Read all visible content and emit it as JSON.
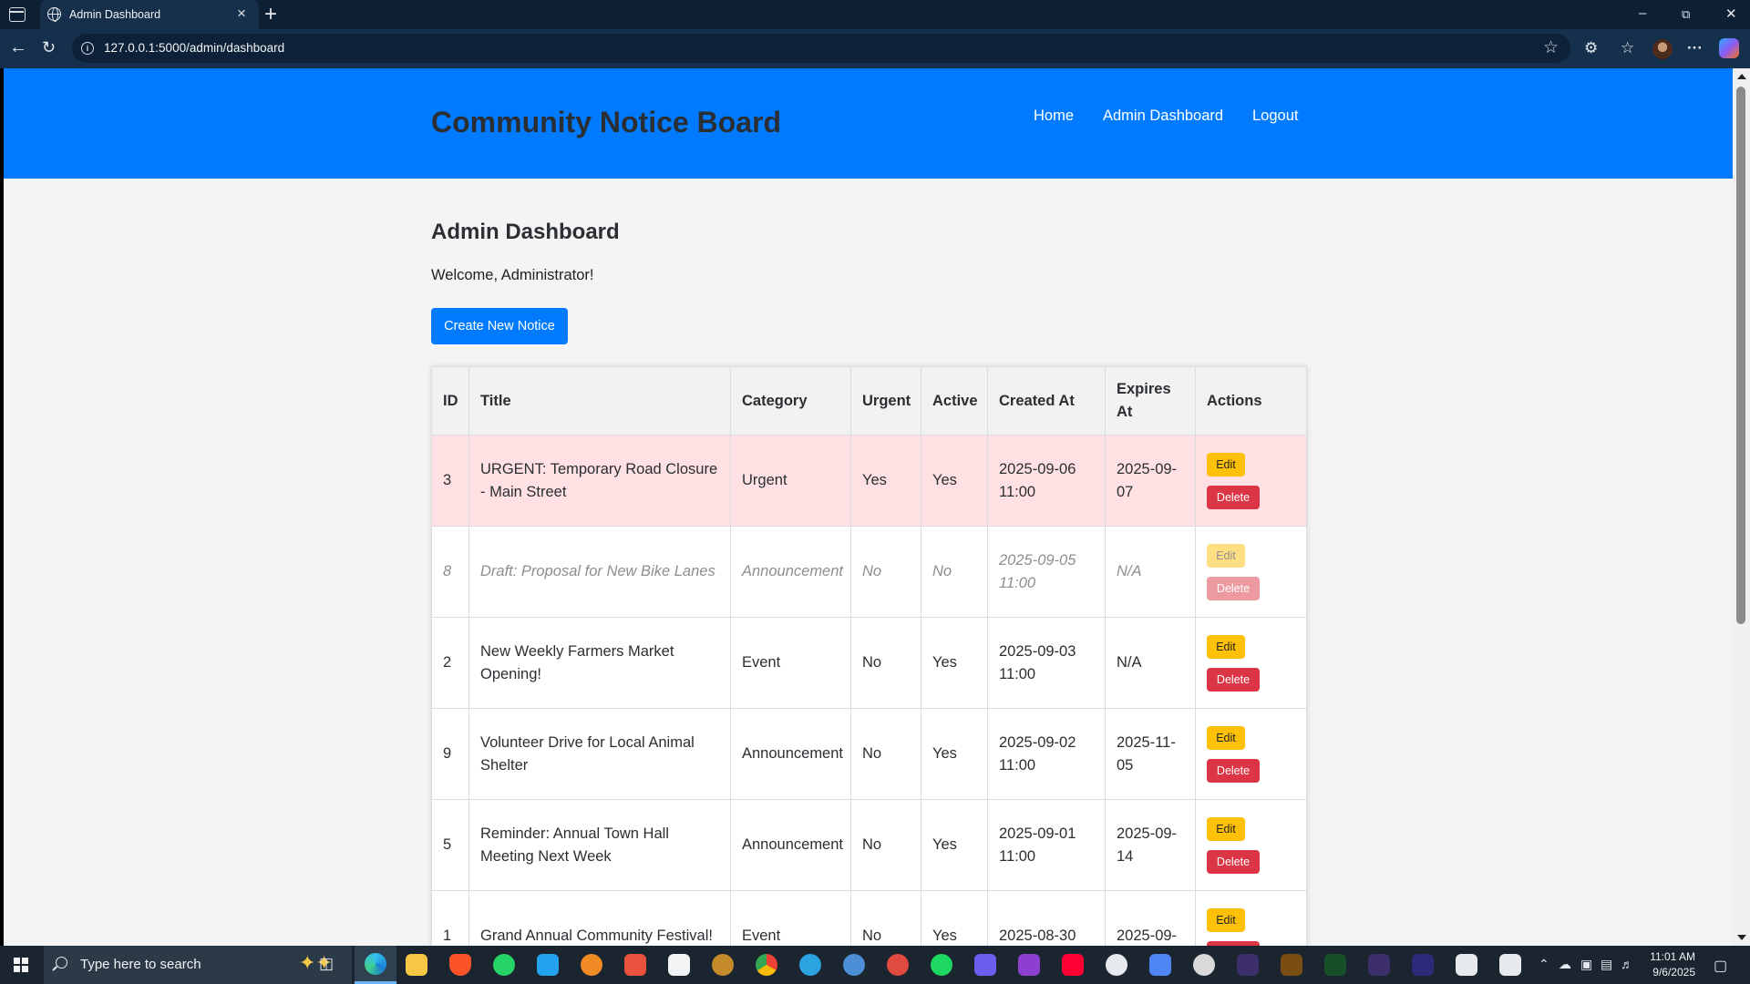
{
  "browser": {
    "tab_title": "Admin Dashboard",
    "url": "127.0.0.1:5000/admin/dashboard"
  },
  "site": {
    "title": "Community Notice Board",
    "nav": [
      "Home",
      "Admin Dashboard",
      "Logout"
    ]
  },
  "dashboard": {
    "heading": "Admin Dashboard",
    "welcome": "Welcome, Administrator!",
    "create_button": "Create New Notice"
  },
  "table": {
    "columns": [
      "ID",
      "Title",
      "Category",
      "Urgent",
      "Active",
      "Created At",
      "Expires At",
      "Actions"
    ],
    "edit_label": "Edit",
    "delete_label": "Delete",
    "rows": [
      {
        "id": "3",
        "title": "URGENT: Temporary Road Closure - Main Street",
        "category": "Urgent",
        "urgent": "Yes",
        "active": "Yes",
        "created": "2025-09-06 11:00",
        "expires": "2025-09-07",
        "state": "urgent"
      },
      {
        "id": "8",
        "title": "Draft: Proposal for New Bike Lanes",
        "category": "Announcement",
        "urgent": "No",
        "active": "No",
        "created": "2025-09-05 11:00",
        "expires": "N/A",
        "state": "inactive"
      },
      {
        "id": "2",
        "title": "New Weekly Farmers Market Opening!",
        "category": "Event",
        "urgent": "No",
        "active": "Yes",
        "created": "2025-09-03 11:00",
        "expires": "N/A",
        "state": "normal"
      },
      {
        "id": "9",
        "title": "Volunteer Drive for Local Animal Shelter",
        "category": "Announcement",
        "urgent": "No",
        "active": "Yes",
        "created": "2025-09-02 11:00",
        "expires": "2025-11-05",
        "state": "normal"
      },
      {
        "id": "5",
        "title": "Reminder: Annual Town Hall Meeting Next Week",
        "category": "Announcement",
        "urgent": "No",
        "active": "Yes",
        "created": "2025-09-01 11:00",
        "expires": "2025-09-14",
        "state": "normal"
      },
      {
        "id": "1",
        "title": "Grand Annual Community Festival!",
        "category": "Event",
        "urgent": "No",
        "active": "Yes",
        "created": "2025-08-30",
        "expires": "2025-09-",
        "state": "normal"
      }
    ]
  },
  "taskbar": {
    "search_placeholder": "Type here to search",
    "time": "11:01 AM",
    "date": "9/6/2025"
  },
  "colors": {
    "brand": "#007bff",
    "edit": "#ffc107",
    "delete": "#dc3545",
    "urgent_row": "#ffe0e3"
  }
}
